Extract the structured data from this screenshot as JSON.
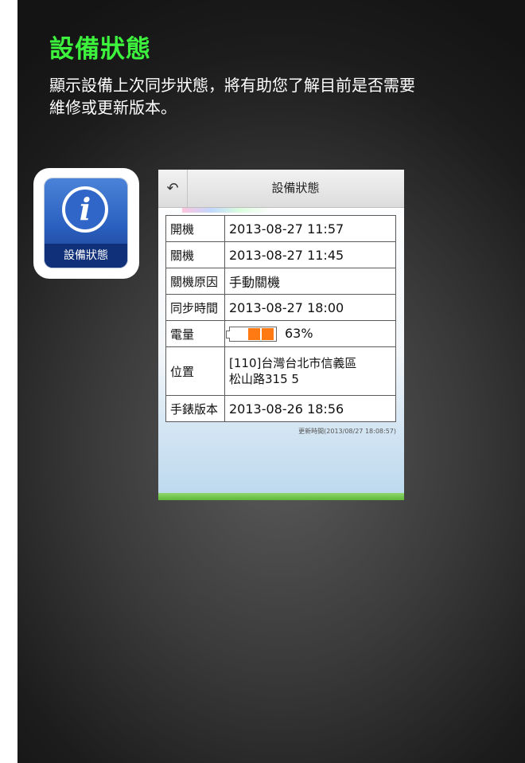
{
  "heading": "設備狀態",
  "description": "顯示設備上次同步狀態，將有助您了解目前是否需要維修或更新版本。",
  "app_icon": {
    "icon": "info-icon",
    "glyph": "i",
    "label": "設備狀態"
  },
  "phone": {
    "back_icon": "back-arrow-icon",
    "back_glyph": "↶",
    "title": "設備狀態",
    "rows": [
      {
        "key": "開機",
        "value": "2013-08-27 11:57"
      },
      {
        "key": "關機",
        "value": "2013-08-27 11:45"
      },
      {
        "key": "關機原因",
        "value": "手動關機"
      },
      {
        "key": "同步時間",
        "value": "2013-08-27 18:00"
      },
      {
        "key": "電量",
        "value": "63%",
        "battery_level": 0.63
      },
      {
        "key": "位置",
        "value_line1": "[110]台灣台北市信義區",
        "value_line2": "松山路315 5"
      },
      {
        "key": "手錶版本",
        "value": "2013-08-26 18:56"
      }
    ],
    "updated_text": "更新時間(2013/08/27 18:08:57)"
  },
  "colors": {
    "heading": "#3df23d",
    "battery_fill": "#ff7a12",
    "icon_blue": "#2a5fbf"
  }
}
